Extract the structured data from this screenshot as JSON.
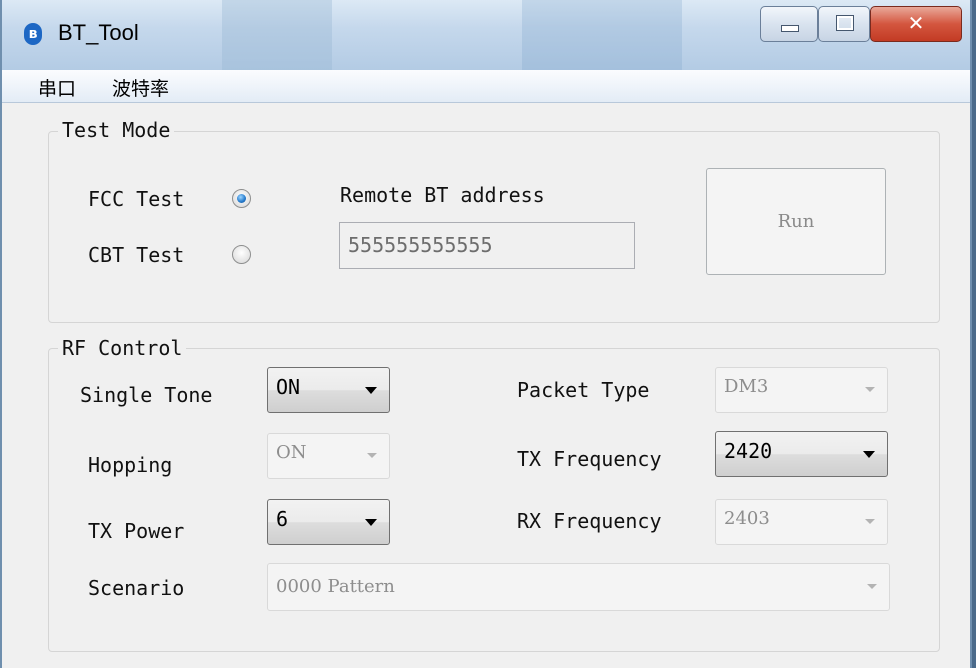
{
  "window": {
    "title": "BT_Tool",
    "icon": "bluetooth-icon"
  },
  "menu": [
    "串口",
    "波特率"
  ],
  "test_mode": {
    "title": "Test Mode",
    "fcc_label": "FCC Test",
    "cbt_label": "CBT Test",
    "selected": "FCC Test",
    "remote_label": "Remote BT address",
    "remote_value": "555555555555",
    "run_label": "Run"
  },
  "rf_control": {
    "title": "RF Control",
    "single_tone": {
      "label": "Single Tone",
      "value": "ON"
    },
    "hopping": {
      "label": "Hopping",
      "value": "ON"
    },
    "tx_power": {
      "label": "TX Power",
      "value": "6"
    },
    "scenario": {
      "label": "Scenario",
      "value": "0000 Pattern"
    },
    "packet_type": {
      "label": "Packet Type",
      "value": "DM3"
    },
    "tx_frequency": {
      "label": "TX Frequency",
      "value": "2420"
    },
    "rx_frequency": {
      "label": "RX Frequency",
      "value": "2403"
    }
  }
}
